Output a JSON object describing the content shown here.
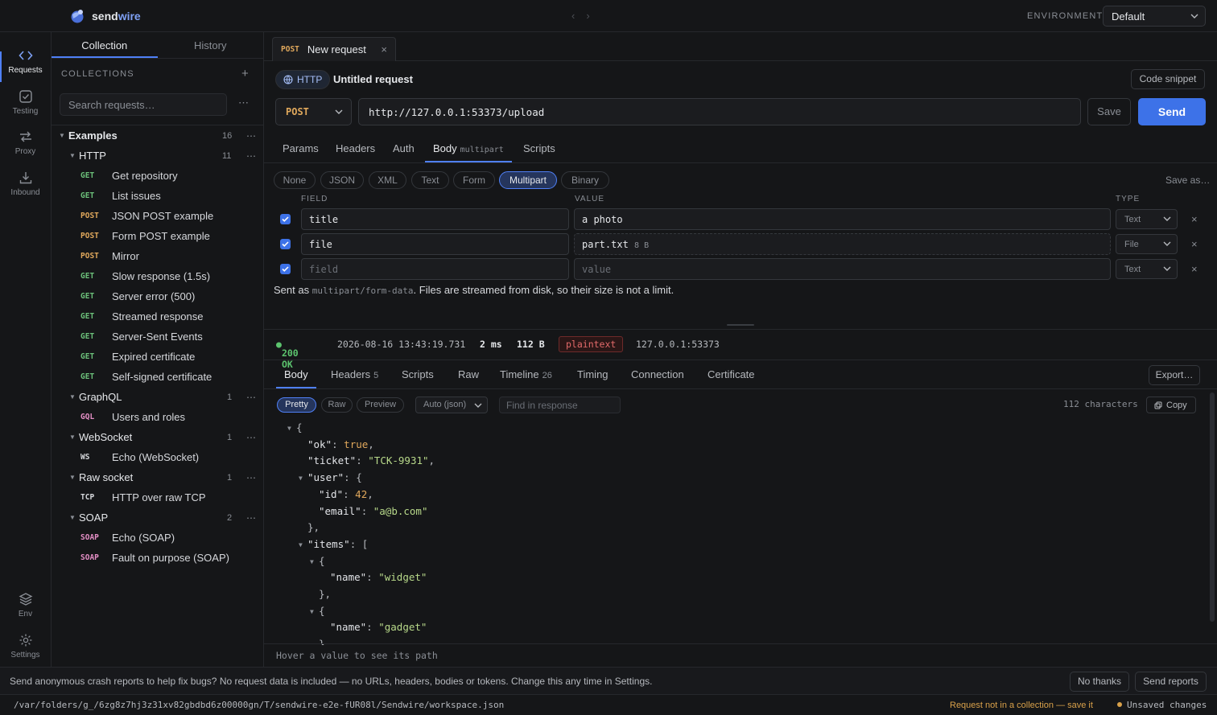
{
  "app": {
    "name_prefix": "send",
    "name_suffix": "wire"
  },
  "topbar": {
    "nav_back": "‹",
    "nav_forward": "›",
    "env_label": "ENVIRONMENT",
    "env_value": "Default"
  },
  "rail": {
    "requests": "Requests",
    "testing": "Testing",
    "proxy": "Proxy",
    "inbound": "Inbound",
    "env": "Env",
    "settings": "Settings"
  },
  "sidebar": {
    "tab_collection": "Collection",
    "tab_history": "History",
    "collections_header": "COLLECTIONS",
    "add": "+",
    "search_placeholder": "Search requests…",
    "more": "⋯",
    "root": {
      "name": "Examples",
      "count": "16"
    },
    "folders": [
      {
        "name": "HTTP",
        "count": "11"
      },
      {
        "name": "GraphQL",
        "count": "1"
      },
      {
        "name": "WebSocket",
        "count": "1"
      },
      {
        "name": "Raw socket",
        "count": "1"
      },
      {
        "name": "SOAP",
        "count": "2"
      }
    ],
    "requests": [
      {
        "method": "GET",
        "name": "Get repository"
      },
      {
        "method": "GET",
        "name": "List issues"
      },
      {
        "method": "POST",
        "name": "JSON POST example"
      },
      {
        "method": "POST",
        "name": "Form POST example"
      },
      {
        "method": "POST",
        "name": "Mirror"
      },
      {
        "method": "GET",
        "name": "Slow response (1.5s)"
      },
      {
        "method": "GET",
        "name": "Server error (500)"
      },
      {
        "method": "GET",
        "name": "Streamed response"
      },
      {
        "method": "GET",
        "name": "Server-Sent Events"
      },
      {
        "method": "GET",
        "name": "Expired certificate"
      },
      {
        "method": "GET",
        "name": "Self-signed certificate"
      },
      {
        "method": "GQL",
        "name": "Users and roles"
      },
      {
        "method": "WS",
        "name": "Echo (WebSocket)"
      },
      {
        "method": "TCP",
        "name": "HTTP over raw TCP"
      },
      {
        "method": "SOAP",
        "name": "Echo (SOAP)"
      },
      {
        "method": "SOAP",
        "name": "Fault on purpose (SOAP)"
      }
    ]
  },
  "tab": {
    "method": "POST",
    "title": "New request",
    "close": "×"
  },
  "request": {
    "protocol": "HTTP",
    "title": "Untitled request",
    "code_snippet": "Code snippet",
    "method": "POST",
    "url": "http://127.0.0.1:53373/upload",
    "save": "Save",
    "send": "Send",
    "tabs": {
      "params": "Params",
      "headers": "Headers",
      "auth": "Auth",
      "body": "Body",
      "body_badge": "multipart",
      "scripts": "Scripts"
    },
    "body_types": [
      "None",
      "JSON",
      "XML",
      "Text",
      "Form",
      "Multipart",
      "Binary"
    ],
    "save_as": "Save as…",
    "col_field": "FIELD",
    "col_value": "VALUE",
    "col_type": "TYPE",
    "rows": [
      {
        "field": "title",
        "value": "a photo",
        "type": "Text"
      },
      {
        "field": "file",
        "value": "part.txt",
        "size": "8 B",
        "type": "File"
      }
    ],
    "new_row": {
      "field_placeholder": "field",
      "value_placeholder": "value",
      "type": "Text"
    },
    "remove": "×",
    "note_prefix": "Sent as ",
    "note_code": "multipart/form-data",
    "note_suffix": ". Files are streamed from disk, so their size is not a limit."
  },
  "response": {
    "status": "200 OK",
    "timestamp": "2026-08-16 13:43:19.731",
    "duration": "2 ms",
    "size": "112 B",
    "content_type": "plaintext",
    "remote": "127.0.0.1:53373",
    "tabs": {
      "body": "Body",
      "headers": "Headers",
      "headers_count": "5",
      "scripts": "Scripts",
      "raw": "Raw",
      "timeline": "Timeline",
      "timeline_count": "26",
      "timing": "Timing",
      "connection": "Connection",
      "certificate": "Certificate"
    },
    "export": "Export…",
    "views": [
      "Pretty",
      "Raw",
      "Preview"
    ],
    "format": "Auto (json)",
    "find_placeholder": "Find in response",
    "char_count": "112 characters",
    "copy": "Copy",
    "hover_hint": "Hover a value to see its path"
  },
  "json_lines": [
    "{",
    "\"ok\": true,",
    "\"ticket\": \"TCK-9931\",",
    "\"user\": {",
    "\"id\": 42,",
    "\"email\": \"a@b.com\"",
    "},",
    "\"items\": [",
    "{",
    "\"name\": \"widget\"",
    "},",
    "{",
    "\"name\": \"gadget\"",
    "}"
  ],
  "crash": {
    "text": "Send anonymous crash reports to help fix bugs? No request data is included — no URLs, headers, bodies or tokens. Change this any time in Settings.",
    "no_thanks": "No thanks",
    "send_reports": "Send reports"
  },
  "footer": {
    "path": "/var/folders/g_/6zg8z7hj3z31xv82gbdbd6z00000gn/T/sendwire-e2e-fUR08l/Sendwire/workspace.json",
    "warning": "Request not in a collection — save it",
    "unsaved": "Unsaved changes"
  },
  "colors": {
    "accent": "#3d72e8",
    "get": "#6cc07a",
    "post": "#e0a85c",
    "gql": "#e58fc6",
    "string": "#b8d98a",
    "number": "#e0a85c",
    "ok": "#5cc46e",
    "warn": "#d9a14a"
  }
}
